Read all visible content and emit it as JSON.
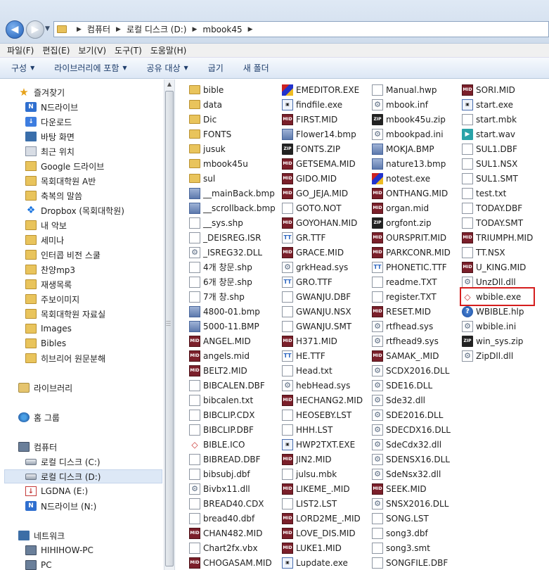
{
  "address": {
    "crumbs": [
      "컴퓨터",
      "로컬 디스크 (D:)",
      "mbook45"
    ]
  },
  "menu": [
    "파일(F)",
    "편집(E)",
    "보기(V)",
    "도구(T)",
    "도움말(H)"
  ],
  "toolbar": {
    "organize": "구성",
    "include_library": "라이브러리에 포함",
    "share": "공유 대상",
    "burn": "굽기",
    "new_folder": "새 폴더"
  },
  "nav": {
    "favorites": "즐겨찾기",
    "fav_items": [
      "N드라이브",
      "다운로드",
      "바탕 화면",
      "최근 위치",
      "Google 드라이브",
      "목회대학원 A반",
      "축복의 말씀",
      "Dropbox (목회대학원)",
      "내 악보",
      "세미나",
      "인터콥 비전 스쿨",
      "찬양mp3",
      "재생목록",
      "주보이미지",
      "목회대학원 자료실",
      "Images",
      "Bibles",
      "히브리어 원문분해"
    ],
    "libraries": "라이브러리",
    "homegroup": "홈 그룹",
    "computer": "컴퓨터",
    "drives": [
      "로컬 디스크 (C:)",
      "로컬 디스크 (D:)",
      "LGDNA (E:)",
      "N드라이브 (N:)"
    ],
    "network": "네트워크",
    "net_items": [
      "HIHIHOW-PC",
      "PC"
    ]
  },
  "files": {
    "col1": [
      {
        "n": "bible",
        "t": "folder"
      },
      {
        "n": "data",
        "t": "folder"
      },
      {
        "n": "Dic",
        "t": "folder"
      },
      {
        "n": "FONTS",
        "t": "folder"
      },
      {
        "n": "jusuk",
        "t": "folder"
      },
      {
        "n": "mbook45u",
        "t": "folder"
      },
      {
        "n": "sul",
        "t": "folder"
      },
      {
        "n": "__mainBack.bmp",
        "t": "img"
      },
      {
        "n": "__scrollback.bmp",
        "t": "img"
      },
      {
        "n": "__sys.shp",
        "t": "generic"
      },
      {
        "n": "_DEISREG.ISR",
        "t": "generic"
      },
      {
        "n": "_ISREG32.DLL",
        "t": "gear"
      },
      {
        "n": "4개 창문.shp",
        "t": "generic"
      },
      {
        "n": "6개 창문.shp",
        "t": "generic"
      },
      {
        "n": "7개 창.shp",
        "t": "generic"
      },
      {
        "n": "4800-01.bmp",
        "t": "img"
      },
      {
        "n": "5000-11.BMP",
        "t": "img"
      },
      {
        "n": "ANGEL.MID",
        "t": "mid"
      },
      {
        "n": "angels.mid",
        "t": "mid"
      },
      {
        "n": "BELT2.MID",
        "t": "mid"
      },
      {
        "n": "BIBCALEN.DBF",
        "t": "generic"
      },
      {
        "n": "bibcalen.txt",
        "t": "generic"
      },
      {
        "n": "BIBCLIP.CDX",
        "t": "generic"
      },
      {
        "n": "BIBCLIP.DBF",
        "t": "generic"
      },
      {
        "n": "BIBLE.ICO",
        "t": "ico"
      },
      {
        "n": "BIBREAD.DBF",
        "t": "generic"
      },
      {
        "n": "bibsubj.dbf",
        "t": "generic"
      },
      {
        "n": "Bivbx11.dll",
        "t": "gear"
      },
      {
        "n": "BREAD40.CDX",
        "t": "generic"
      },
      {
        "n": "bread40.dbf",
        "t": "generic"
      },
      {
        "n": "CHAN482.MID",
        "t": "mid"
      },
      {
        "n": "Chart2fx.vbx",
        "t": "generic"
      },
      {
        "n": "CHOGASAM.MID",
        "t": "mid"
      }
    ],
    "col2": [
      {
        "n": "EMEDITOR.EXE",
        "t": "emed"
      },
      {
        "n": "findfile.exe",
        "t": "exe"
      },
      {
        "n": "FIRST.MID",
        "t": "mid"
      },
      {
        "n": "Flower14.bmp",
        "t": "img"
      },
      {
        "n": "FONTS.ZIP",
        "t": "zip"
      },
      {
        "n": "GETSEMA.MID",
        "t": "mid"
      },
      {
        "n": "GIDO.MID",
        "t": "mid"
      },
      {
        "n": "GO_JEJA.MID",
        "t": "mid"
      },
      {
        "n": "GOTO.NOT",
        "t": "generic"
      },
      {
        "n": "GOYOHAN.MID",
        "t": "mid"
      },
      {
        "n": "GR.TTF",
        "t": "ttf"
      },
      {
        "n": "GRACE.MID",
        "t": "mid"
      },
      {
        "n": "grkHead.sys",
        "t": "gear"
      },
      {
        "n": "GRO.TTF",
        "t": "ttf"
      },
      {
        "n": "GWANJU.DBF",
        "t": "generic"
      },
      {
        "n": "GWANJU.NSX",
        "t": "generic"
      },
      {
        "n": "GWANJU.SMT",
        "t": "generic"
      },
      {
        "n": "H371.MID",
        "t": "mid"
      },
      {
        "n": "HE.TTF",
        "t": "ttf"
      },
      {
        "n": "Head.txt",
        "t": "generic"
      },
      {
        "n": "hebHead.sys",
        "t": "gear"
      },
      {
        "n": "HECHANG2.MID",
        "t": "mid"
      },
      {
        "n": "HEOSEBY.LST",
        "t": "generic"
      },
      {
        "n": "HHH.LST",
        "t": "generic"
      },
      {
        "n": "HWP2TXT.EXE",
        "t": "exe"
      },
      {
        "n": "JIN2.MID",
        "t": "mid"
      },
      {
        "n": "julsu.mbk",
        "t": "generic"
      },
      {
        "n": "LIKEME_.MID",
        "t": "mid"
      },
      {
        "n": "LIST2.LST",
        "t": "generic"
      },
      {
        "n": "LORD2ME_.MID",
        "t": "mid"
      },
      {
        "n": "LOVE_DIS.MID",
        "t": "mid"
      },
      {
        "n": "LUKE1.MID",
        "t": "mid"
      },
      {
        "n": "Lupdate.exe",
        "t": "exe"
      }
    ],
    "col3": [
      {
        "n": "Manual.hwp",
        "t": "generic"
      },
      {
        "n": "mbook.inf",
        "t": "gear"
      },
      {
        "n": "mbook45u.zip",
        "t": "zip"
      },
      {
        "n": "mbookpad.ini",
        "t": "gear"
      },
      {
        "n": "MOKJA.BMP",
        "t": "img"
      },
      {
        "n": "nature13.bmp",
        "t": "img"
      },
      {
        "n": "notest.exe",
        "t": "emed"
      },
      {
        "n": "ONTHANG.MID",
        "t": "mid"
      },
      {
        "n": "organ.mid",
        "t": "mid"
      },
      {
        "n": "orgfont.zip",
        "t": "zip"
      },
      {
        "n": "OURSPRIT.MID",
        "t": "mid"
      },
      {
        "n": "PARKCONR.MID",
        "t": "mid"
      },
      {
        "n": "PHONETIC.TTF",
        "t": "ttf"
      },
      {
        "n": "readme.TXT",
        "t": "generic"
      },
      {
        "n": "register.TXT",
        "t": "generic"
      },
      {
        "n": "RESET.MID",
        "t": "mid"
      },
      {
        "n": "rtfhead.sys",
        "t": "gear"
      },
      {
        "n": "rtfhead9.sys",
        "t": "gear"
      },
      {
        "n": "SAMAK_.MID",
        "t": "mid"
      },
      {
        "n": "SCDX2016.DLL",
        "t": "gear"
      },
      {
        "n": "SDE16.DLL",
        "t": "gear"
      },
      {
        "n": "Sde32.dll",
        "t": "gear"
      },
      {
        "n": "SDE2016.DLL",
        "t": "gear"
      },
      {
        "n": "SDECDX16.DLL",
        "t": "gear"
      },
      {
        "n": "SdeCdx32.dll",
        "t": "gear"
      },
      {
        "n": "SDENSX16.DLL",
        "t": "gear"
      },
      {
        "n": "SdeNsx32.dll",
        "t": "gear"
      },
      {
        "n": "SEEK.MID",
        "t": "mid"
      },
      {
        "n": "SNSX2016.DLL",
        "t": "gear"
      },
      {
        "n": "SONG.LST",
        "t": "generic"
      },
      {
        "n": "song3.dbf",
        "t": "generic"
      },
      {
        "n": "song3.smt",
        "t": "generic"
      },
      {
        "n": "SONGFILE.DBF",
        "t": "generic"
      }
    ],
    "col4": [
      {
        "n": "SORI.MID",
        "t": "mid"
      },
      {
        "n": "start.exe",
        "t": "exe"
      },
      {
        "n": "start.mbk",
        "t": "generic"
      },
      {
        "n": "start.wav",
        "t": "wav"
      },
      {
        "n": "SUL1.DBF",
        "t": "generic"
      },
      {
        "n": "SUL1.NSX",
        "t": "generic"
      },
      {
        "n": "SUL1.SMT",
        "t": "generic"
      },
      {
        "n": "test.txt",
        "t": "generic"
      },
      {
        "n": "TODAY.DBF",
        "t": "generic"
      },
      {
        "n": "TODAY.SMT",
        "t": "generic"
      },
      {
        "n": "TRIUMPH.MID",
        "t": "mid"
      },
      {
        "n": "TT.NSX",
        "t": "generic"
      },
      {
        "n": "U_KING.MID",
        "t": "mid"
      },
      {
        "n": "UnzDll.dll",
        "t": "gear"
      },
      {
        "n": "wbible.exe",
        "t": "ico",
        "hl": true
      },
      {
        "n": "WBIBLE.hlp",
        "t": "hlp"
      },
      {
        "n": "wbible.ini",
        "t": "gear"
      },
      {
        "n": "win_sys.zip",
        "t": "zip"
      },
      {
        "n": "ZipDll.dll",
        "t": "gear"
      }
    ]
  }
}
